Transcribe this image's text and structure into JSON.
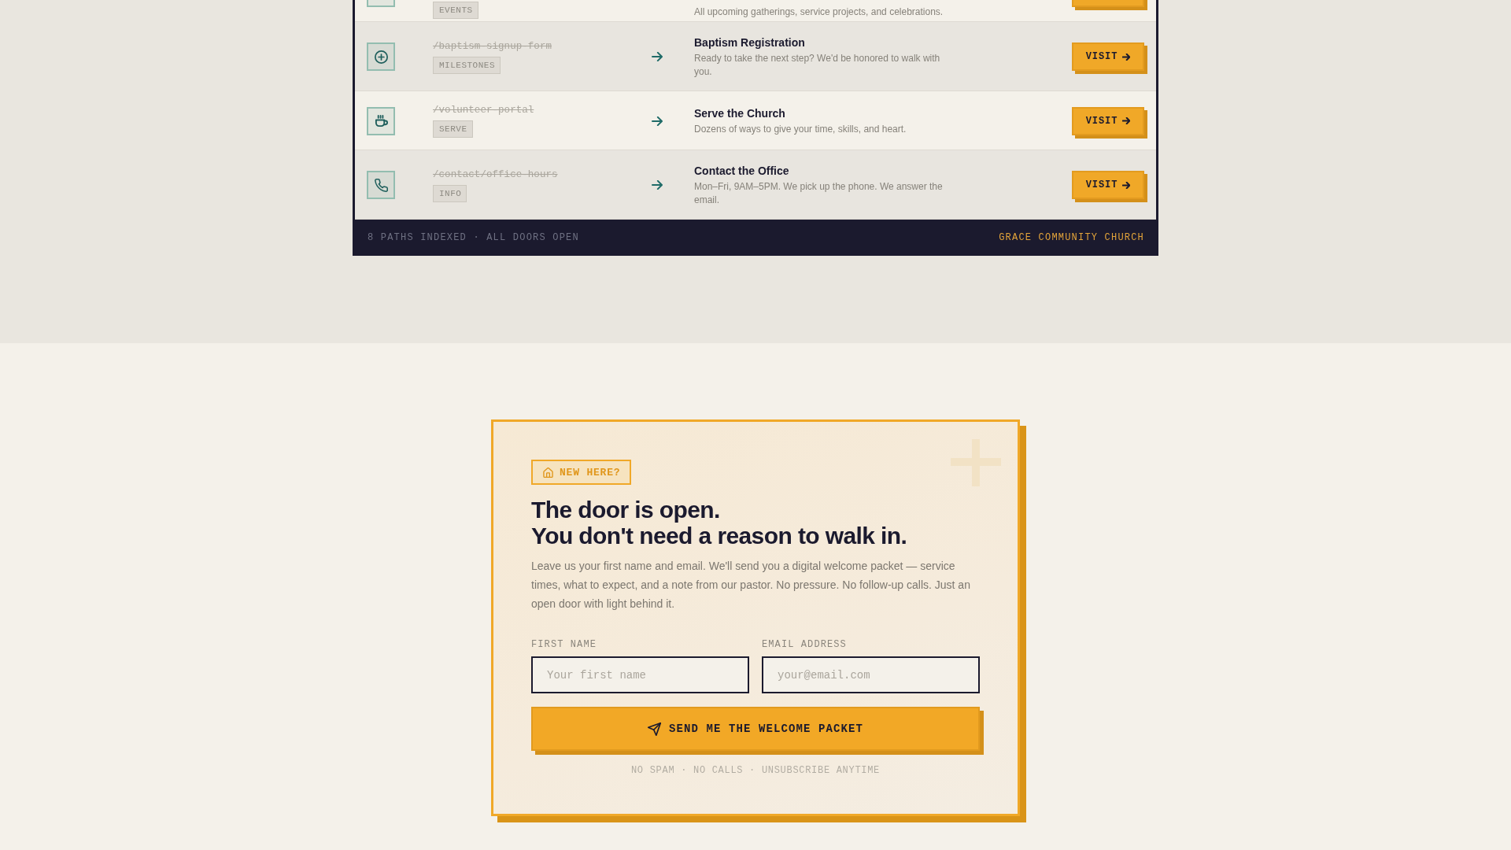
{
  "directory": {
    "rows": [
      {
        "kind": "event",
        "tag": "EVENTS",
        "description": "All upcoming gatherings, service projects, and celebrations."
      },
      {
        "kind": "milestone",
        "path": "/baptism-signup-form",
        "tag": "MILESTONES",
        "title": "Baptism Registration",
        "description": "Ready to take the next step? We'd be honored to walk with you.",
        "button": "VISIT"
      },
      {
        "kind": "serve",
        "path": "/volunteer-portal",
        "tag": "SERVE",
        "title": "Serve the Church",
        "description": "Dozens of ways to give your time, skills, and heart.",
        "button": "VISIT"
      },
      {
        "kind": "contact",
        "path": "/contact/office-hours",
        "tag": "INFO",
        "title": "Contact the Office",
        "description": "Mon–Fri, 9AM–5PM. We pick up the phone. We answer the email.",
        "button": "VISIT"
      }
    ],
    "footer": {
      "status": "8 PATHS INDEXED · ALL DOORS OPEN",
      "brand": "GRACE COMMUNITY CHURCH"
    }
  },
  "signup": {
    "badge": "NEW HERE?",
    "heading": "The door is open.\nYou don't need a reason to walk in.",
    "intro": "Leave us your first name and email. We'll send you a digital welcome packet — service times, what to expect, and a note from our pastor. No pressure. No follow-up calls. Just an open door with light behind it.",
    "fields": [
      {
        "label": "FIRST NAME",
        "placeholder": "Your first name"
      },
      {
        "label": "EMAIL ADDRESS",
        "placeholder": "your@email.com"
      }
    ],
    "submit": "SEND ME THE WELCOME PACKET",
    "note": "NO SPAM · NO CALLS · UNSUBSCRIBE ANYTIME"
  }
}
